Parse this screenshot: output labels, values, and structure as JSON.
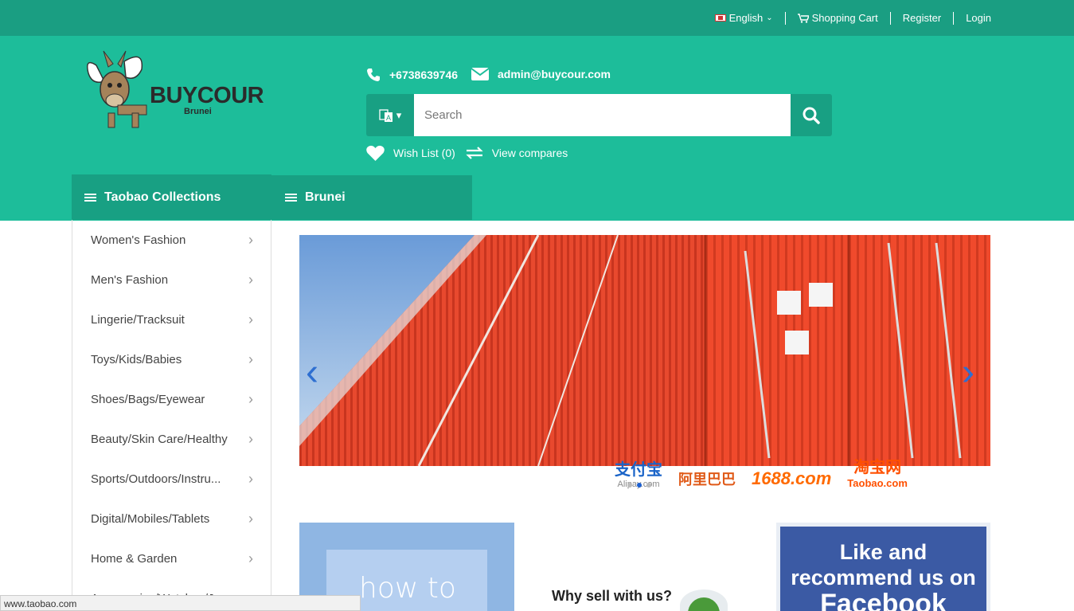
{
  "topnav": {
    "language": "English",
    "cart": "Shopping Cart",
    "register": "Register",
    "login": "Login"
  },
  "logo": {
    "name": "BUYCOUR",
    "sub": "Brunei"
  },
  "contact": {
    "phone": "+6738639746",
    "email": "admin@buycour.com"
  },
  "search": {
    "placeholder": "Search"
  },
  "links": {
    "wishlist": "Wish List (0)",
    "compare": "View compares"
  },
  "menu": {
    "collections": "Taobao Collections",
    "brunei": "Brunei"
  },
  "categories": [
    "Women's Fashion",
    "Men's Fashion",
    "Lingerie/Tracksuit",
    "Toys/Kids/Babies",
    "Shoes/Bags/Eyewear",
    "Beauty/Skin Care/Healthy",
    "Sports/Outdoors/Instru...",
    "Digital/Mobiles/Tablets",
    "Home & Garden",
    "Accessories/Watches/Je..."
  ],
  "banner": {
    "brands": [
      "支付宝",
      "Alipay.com",
      "阿里巴巴",
      "1688.com",
      "淘宝网",
      "Taobao.com"
    ]
  },
  "tiles": {
    "howto": "how to",
    "why": "Why sell with us?",
    "fb1": "Like and",
    "fb2": "recommend us on",
    "fb3": "Facebook"
  },
  "status": "www.taobao.com",
  "colors": {
    "topbar": "#1a9e82",
    "header": "#1dbd9a",
    "accent": "#18a083"
  }
}
